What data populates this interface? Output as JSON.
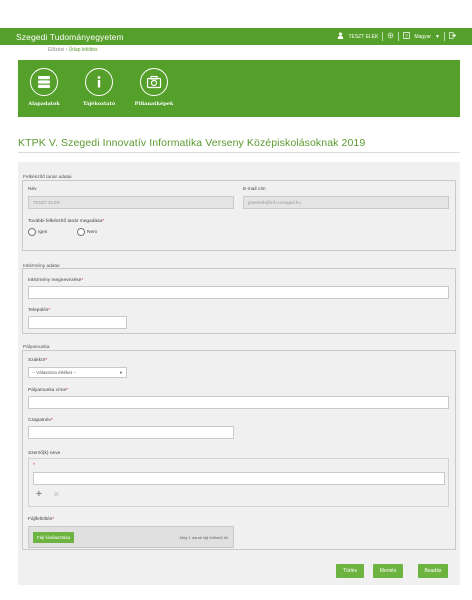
{
  "header": {
    "brand": "Szegedi Tudományegyetem",
    "ghost_text": "",
    "user_name": "TESZT ELEK",
    "language": "Magyar",
    "user_icon": "user-icon",
    "settings_icon": "gear-icon",
    "help_icon": "help-icon",
    "logout_icon": "logout-icon"
  },
  "breadcrumb": {
    "home": "Előzési",
    "separator": "›",
    "current": "Űrlap kitöltés"
  },
  "nav_tiles": [
    {
      "label": "Alapadatok",
      "icon": "database-icon"
    },
    {
      "label": "Tájékoztató",
      "icon": "info-icon"
    },
    {
      "label": "Pillanatképek",
      "icon": "camera-icon"
    }
  ],
  "page_title": "KTPK V. Szegedi Innovatív Informatika Verseny Középiskolásoknak 2019",
  "teacher_section": {
    "title": "Felkészítő tanár adatai",
    "name_label": "Név",
    "name_value": "TESZT ELEK",
    "email_label": "E-mail cím",
    "email_value": "gnemeth@inf.u-szeged.hu",
    "more_label": "További felkészítő tanár megadása",
    "radio_yes": "Igen",
    "radio_no": "Nem"
  },
  "institution_section": {
    "title": "Intézmény adatai",
    "name_label": "Intézmény megnevezése",
    "city_label": "Település"
  },
  "project_section": {
    "title": "Pályamunka",
    "category_label": "Szakkör",
    "category_value": "-- Válasszon értéket --",
    "work_title_label": "Pályamunka címe",
    "team_label": "Csapatnév",
    "authors_label": "Szerző(k) neve",
    "files_label": "Fájlfeltöltés",
    "file_button": "Fájl kiválasztása",
    "file_note": "Még 1 darab fájl tölthető fel."
  },
  "actions": {
    "delete": "Törlés",
    "save": "Mentés",
    "submit": "Beadás"
  },
  "colors": {
    "brand_green": "#55a02a",
    "button_green": "#6db33f",
    "title_green": "#5a9a2f"
  }
}
